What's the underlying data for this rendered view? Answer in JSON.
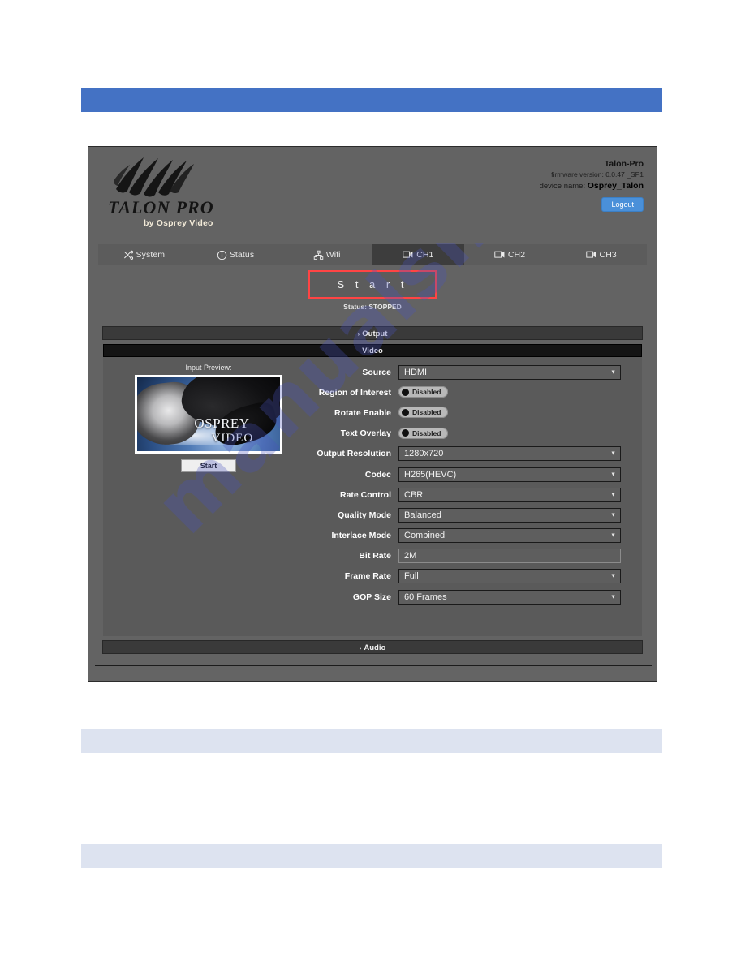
{
  "document": {
    "bars": [
      "",
      "",
      ""
    ],
    "watermark": "manualslib.com"
  },
  "app": {
    "logo": {
      "title": "TALON PRO",
      "subtitle": "by Osprey Video",
      "icon": "claw-marks-icon"
    },
    "header": {
      "product": "Talon-Pro",
      "firmware_label": "firmware version:",
      "firmware_value": "0.0.47 _SP1",
      "device_label": "device name:",
      "device_value": "Osprey_Talon",
      "logout_label": "Logout"
    },
    "tabs": [
      {
        "label": "System",
        "icon": "tools-icon",
        "active": false
      },
      {
        "label": "Status",
        "icon": "info-circle-icon",
        "active": false
      },
      {
        "label": "Wifi",
        "icon": "network-icon",
        "active": false
      },
      {
        "label": "CH1",
        "icon": "video-monitor-icon",
        "active": true
      },
      {
        "label": "CH2",
        "icon": "video-monitor-icon",
        "active": false
      },
      {
        "label": "CH3",
        "icon": "video-monitor-icon",
        "active": false
      }
    ],
    "control": {
      "start_label": "S t a r t",
      "start_border_color": "#ff4444",
      "status_text": "Status: STOPPED"
    },
    "sections": {
      "output_label": "Output",
      "video_label": "Video",
      "audio_label": "Audio",
      "caret": "›"
    },
    "preview": {
      "label": "Input Preview:",
      "image_text_line1": "OSPREY",
      "image_text_line2": "VIDEO",
      "start_label": "Start"
    },
    "form": {
      "rows": [
        {
          "label": "Source",
          "type": "select",
          "value": "HDMI"
        },
        {
          "label": "Region of Interest",
          "type": "toggle",
          "value": "Disabled"
        },
        {
          "label": "Rotate Enable",
          "type": "toggle",
          "value": "Disabled"
        },
        {
          "label": "Text Overlay",
          "type": "toggle",
          "value": "Disabled"
        },
        {
          "label": "Output Resolution",
          "type": "select",
          "value": "1280x720"
        },
        {
          "label": "Codec",
          "type": "select",
          "value": "H265(HEVC)"
        },
        {
          "label": "Rate Control",
          "type": "select",
          "value": "CBR"
        },
        {
          "label": "Quality Mode",
          "type": "select",
          "value": "Balanced"
        },
        {
          "label": "Interlace Mode",
          "type": "select",
          "value": "Combined"
        },
        {
          "label": "Bit Rate",
          "type": "text",
          "value": "2M"
        },
        {
          "label": "Frame Rate",
          "type": "select",
          "value": "Full"
        },
        {
          "label": "GOP Size",
          "type": "select",
          "value": "60 Frames"
        }
      ]
    }
  },
  "colors": {
    "doc_bar_blue": "#4472c4",
    "doc_bar_light": "#dde3f0",
    "app_bg": "#636363",
    "panel_bg": "#5a5a5a",
    "section_dark": "#3a3a3a",
    "video_header": "#141414",
    "accent_red": "#ff4444",
    "logout_blue": "#4a90d9",
    "watermark": "#4a54be"
  }
}
